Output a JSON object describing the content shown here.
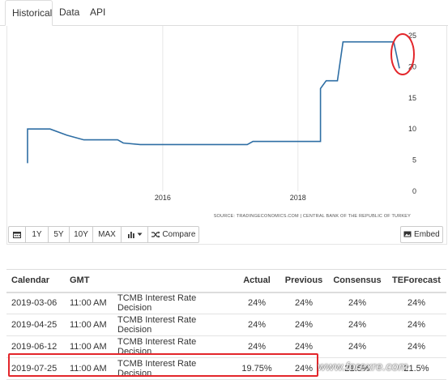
{
  "tabs": [
    {
      "label": "Historical",
      "active": true
    },
    {
      "label": "Data",
      "active": false
    },
    {
      "label": "API",
      "active": false
    }
  ],
  "chart_data": {
    "type": "line",
    "title": "",
    "xlabel": "",
    "ylabel": "",
    "x_ticks": [
      "2016",
      "2018"
    ],
    "y_ticks": [
      0,
      5,
      10,
      15,
      20,
      25
    ],
    "ylim": [
      0,
      25
    ],
    "series": [
      {
        "color": "#2e6ea4",
        "points": [
          [
            "2014-01",
            4.5
          ],
          [
            "2014-01",
            10
          ],
          [
            "2014-05",
            10
          ],
          [
            "2014-08",
            9
          ],
          [
            "2014-11",
            8.25
          ],
          [
            "2015-02",
            8.25
          ],
          [
            "2015-05",
            8.25
          ],
          [
            "2015-06",
            7.75
          ],
          [
            "2015-09",
            7.5
          ],
          [
            "2016-01",
            7.5
          ],
          [
            "2016-06",
            7.5
          ],
          [
            "2017-01",
            7.5
          ],
          [
            "2017-04",
            7.5
          ],
          [
            "2017-05",
            8.0
          ],
          [
            "2018-01",
            8.0
          ],
          [
            "2018-05",
            8.0
          ],
          [
            "2018-05",
            16.5
          ],
          [
            "2018-06",
            17.75
          ],
          [
            "2018-08",
            17.75
          ],
          [
            "2018-09",
            24
          ],
          [
            "2019-06",
            24
          ],
          [
            "2019-07",
            19.75
          ]
        ]
      }
    ],
    "source": "SOURCE: TRADINGECONOMICS.COM | CENTRAL BANK OF THE REPUBLIC OF TURKEY",
    "grid": true
  },
  "toolbar": {
    "range_buttons": [
      "1Y",
      "5Y",
      "10Y",
      "MAX"
    ],
    "compare_label": "Compare",
    "embed_label": "Embed",
    "calendar_icon": "calendar-icon",
    "chart_type_icon": "bar-chart-icon",
    "compare_icon": "shuffle-icon",
    "embed_icon": "image-icon"
  },
  "calendar": {
    "headers": [
      "Calendar",
      "GMT",
      "",
      "Actual",
      "Previous",
      "Consensus",
      "TEForecast"
    ],
    "rows": [
      [
        "2019-03-06",
        "11:00 AM",
        "TCMB Interest Rate Decision",
        "24%",
        "24%",
        "24%",
        "24%"
      ],
      [
        "2019-04-25",
        "11:00 AM",
        "TCMB Interest Rate Decision",
        "24%",
        "24%",
        "24%",
        "24%"
      ],
      [
        "2019-06-12",
        "11:00 AM",
        "TCMB Interest Rate Decision",
        "24%",
        "24%",
        "24%",
        "24%"
      ],
      [
        "2019-07-25",
        "11:00 AM",
        "TCMB Interest Rate Decision",
        "19.75%",
        "24%",
        "21.5%",
        "21.5%"
      ]
    ]
  },
  "annotation_colors": {
    "highlight": "#e3262b",
    "line": "#2e6ea4"
  },
  "watermark": "www.forexre.com"
}
